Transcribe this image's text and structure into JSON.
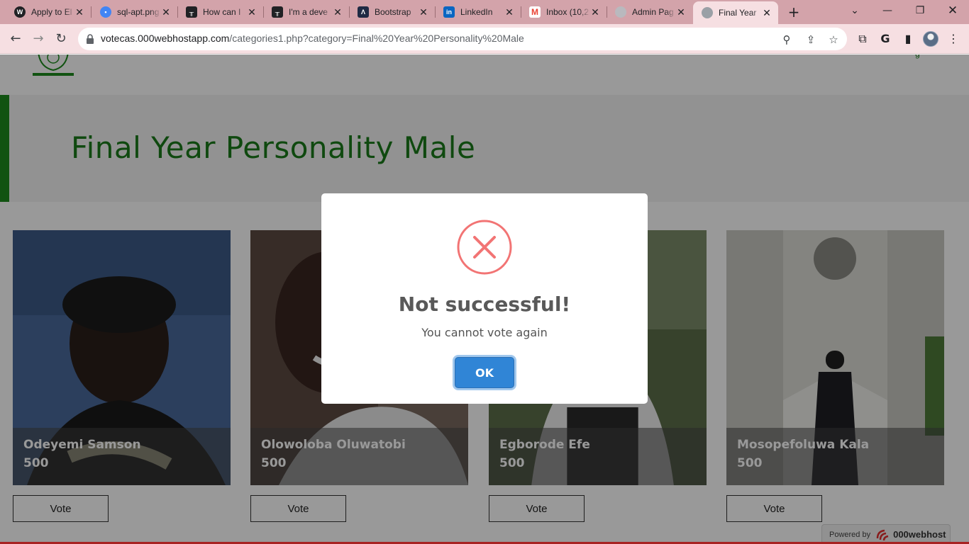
{
  "browser": {
    "tabs": [
      {
        "title": "Apply to El",
        "icon": "wordpress-icon",
        "color": "#202124"
      },
      {
        "title": "sql-apt.png",
        "icon": "image-file-icon",
        "color": "#4285f4"
      },
      {
        "title": "How can I",
        "icon": "stack-icon",
        "color": "#202124"
      },
      {
        "title": "I'm a deve",
        "icon": "stack-icon",
        "color": "#202124"
      },
      {
        "title": "Bootstrap",
        "icon": "bootstrap-icon",
        "color": "#1f2a44"
      },
      {
        "title": "LinkedIn",
        "icon": "linkedin-icon",
        "color": "#0a66c2"
      },
      {
        "title": "Inbox (10,2",
        "icon": "gmail-icon",
        "color": "#ea4335"
      },
      {
        "title": "Admin Pag",
        "icon": "globe-icon",
        "color": "#9aa0a6"
      },
      {
        "title": "Final Year",
        "icon": "globe-icon",
        "color": "#9aa0a6",
        "active": true
      }
    ],
    "url_host": "votecas.000webhostapp.com",
    "url_path": "/categories1.php?category=Final%20Year%20Personality%20Male"
  },
  "page": {
    "title": "Final Year Personality Male",
    "accent_color": "#1a7a1a",
    "candidates": [
      {
        "name": "Odeyemi Samson",
        "votes": "500",
        "vote_label": "Vote"
      },
      {
        "name": "Olowoloba Oluwatobi",
        "votes": "500",
        "vote_label": "Vote"
      },
      {
        "name": "Egborode Efe",
        "votes": "500",
        "vote_label": "Vote"
      },
      {
        "name": "Mosopefoluwa Kala",
        "votes": "500",
        "vote_label": "Vote"
      }
    ],
    "powered_by": "Powered by",
    "powered_brand": "000webhost"
  },
  "modal": {
    "icon": "error-x-icon",
    "title": "Not successful!",
    "text": "You cannot vote again",
    "ok_label": "OK",
    "icon_color": "#f27474",
    "button_color": "#3085d6"
  }
}
